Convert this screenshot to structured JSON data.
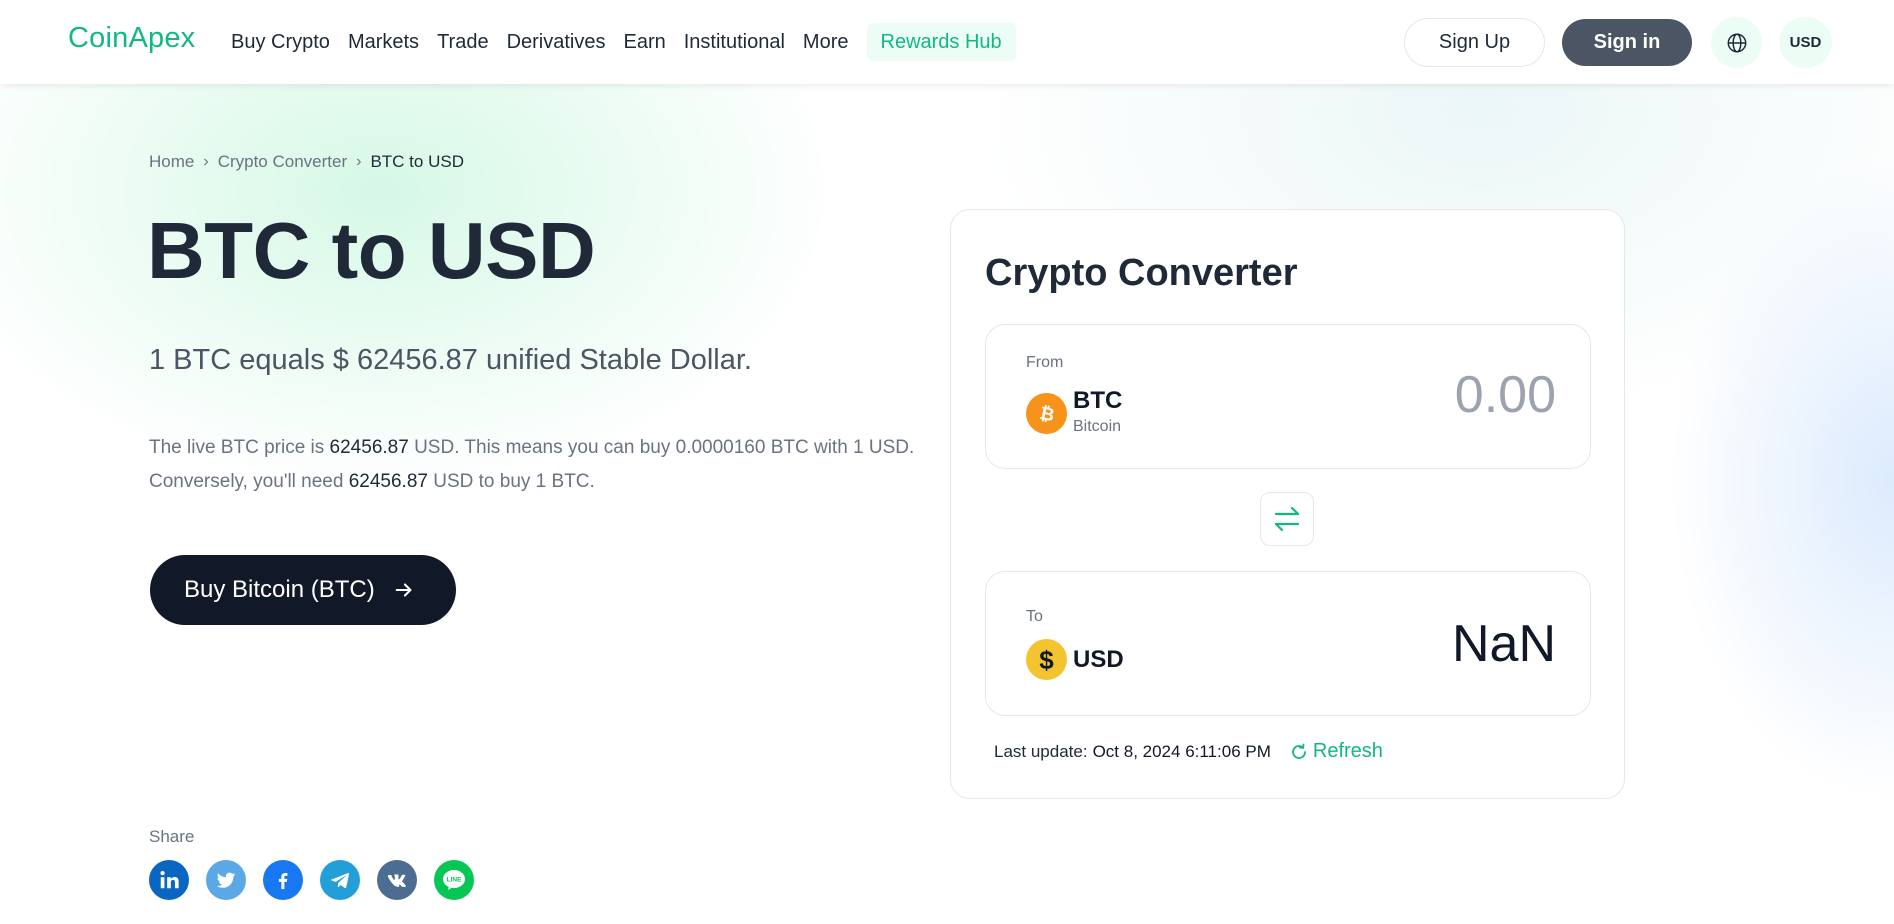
{
  "header": {
    "logo": "CoinApex",
    "nav": [
      "Buy Crypto",
      "Markets",
      "Trade",
      "Derivatives",
      "Earn",
      "Institutional",
      "More"
    ],
    "highlight": "Rewards Hub",
    "sign_up": "Sign Up",
    "sign_in": "Sign in",
    "currency": "USD",
    "language_icon": "globe-icon"
  },
  "breadcrumb": {
    "home": "Home",
    "converter": "Crypto Converter",
    "current": "BTC to USD"
  },
  "hero": {
    "title": "BTC to USD",
    "subtitle": "1 BTC equals $ 62456.87 unified Stable Dollar.",
    "desc": {
      "part1": "The live BTC price is ",
      "price": "62456.87",
      "part2": " USD. This means you can buy 0.0000160 BTC with 1 USD.",
      "part3": "Conversely, you'll need ",
      "price2": "62456.87",
      "part4": " USD to buy 1 BTC."
    },
    "buy_button": "Buy Bitcoin (BTC)"
  },
  "share": {
    "label": "Share",
    "networks": [
      "linkedin-icon",
      "twitter-icon",
      "facebook-icon",
      "telegram-icon",
      "vk-icon",
      "line-icon"
    ]
  },
  "converter": {
    "title": "Crypto Converter",
    "from": {
      "label": "From",
      "symbol": "BTC",
      "name": "Bitcoin",
      "placeholder": "0.00",
      "value": ""
    },
    "to": {
      "label": "To",
      "symbol": "USD",
      "value": "NaN"
    },
    "last_update_label": "Last update:",
    "last_update_time": "Oct 8, 2024 6:11:06 PM",
    "refresh": "Refresh"
  },
  "colors": {
    "brand": "#10b981",
    "dark": "#111827",
    "btc": "#f7931a",
    "usd": "#f4c430"
  }
}
